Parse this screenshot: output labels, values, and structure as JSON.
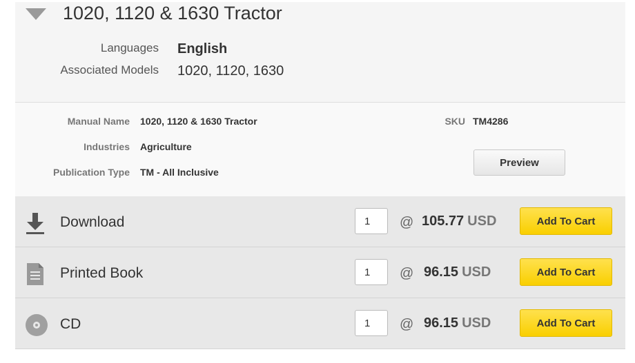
{
  "product": {
    "title": "1020, 1120 & 1630 Tractor",
    "languages_label": "Languages",
    "languages_value": "English",
    "models_label": "Associated Models",
    "models_value": "1020, 1120, 1630"
  },
  "details": {
    "manual_name_label": "Manual Name",
    "manual_name_value": "1020, 1120 & 1630 Tractor",
    "industries_label": "Industries",
    "industries_value": "Agriculture",
    "publication_type_label": "Publication Type",
    "publication_type_value": "TM - All Inclusive",
    "sku_label": "SKU",
    "sku_value": "TM4286",
    "preview_label": "Preview"
  },
  "formats": [
    {
      "label": "Download",
      "icon": "download-icon",
      "qty": "1",
      "at": "@",
      "price": "105.77",
      "currency": "USD",
      "button": "Add To Cart"
    },
    {
      "label": "Printed Book",
      "icon": "document-icon",
      "qty": "1",
      "at": "@",
      "price": "96.15",
      "currency": "USD",
      "button": "Add To Cart"
    },
    {
      "label": "CD",
      "icon": "disc-icon",
      "qty": "1",
      "at": "@",
      "price": "96.15",
      "currency": "USD",
      "button": "Add To Cart"
    }
  ],
  "colors": {
    "accent": "#f9cf00",
    "header_bg": "#f5f5f5",
    "row_bg": "#e8e8e8"
  }
}
